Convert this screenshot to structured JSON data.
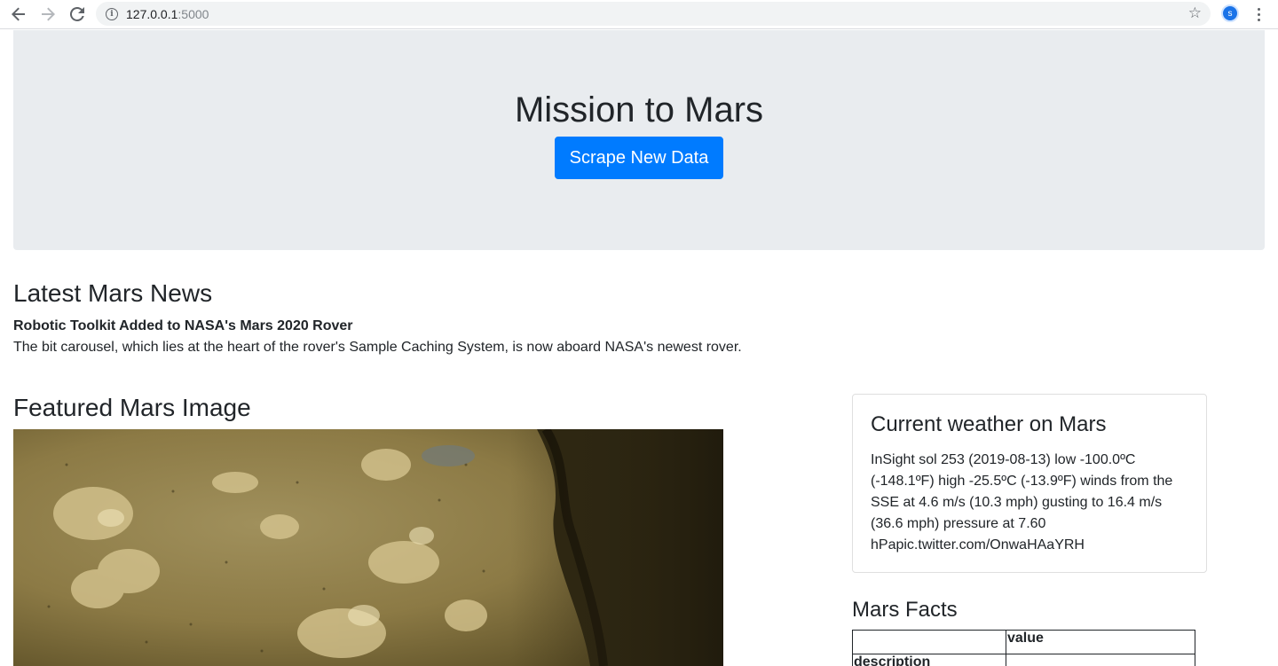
{
  "browser": {
    "url_host": "127.0.0.1",
    "url_port": ":5000",
    "profile_initial": "s"
  },
  "jumbotron": {
    "title": "Mission to Mars",
    "button_label": "Scrape New Data"
  },
  "news": {
    "section_title": "Latest Mars News",
    "headline": "Robotic Toolkit Added to NASA's Mars 2020 Rover",
    "teaser": "The bit carousel, which lies at the heart of the rover's Sample Caching System, is now aboard NASA's newest rover."
  },
  "featured_image": {
    "section_title": "Featured Mars Image"
  },
  "weather": {
    "card_title": "Current weather on Mars",
    "text": "InSight sol 253 (2019-08-13) low -100.0ºC (-148.1ºF) high -25.5ºC (-13.9ºF) winds from the SSE at 4.6 m/s (10.3 mph) gusting to 16.4 m/s (36.6 mph) pressure at 7.60 hPapic.twitter.com/OnwaHAaYRH"
  },
  "facts": {
    "section_title": "Mars Facts",
    "headers": [
      "",
      "value"
    ],
    "rows": [
      [
        "description",
        ""
      ]
    ]
  }
}
